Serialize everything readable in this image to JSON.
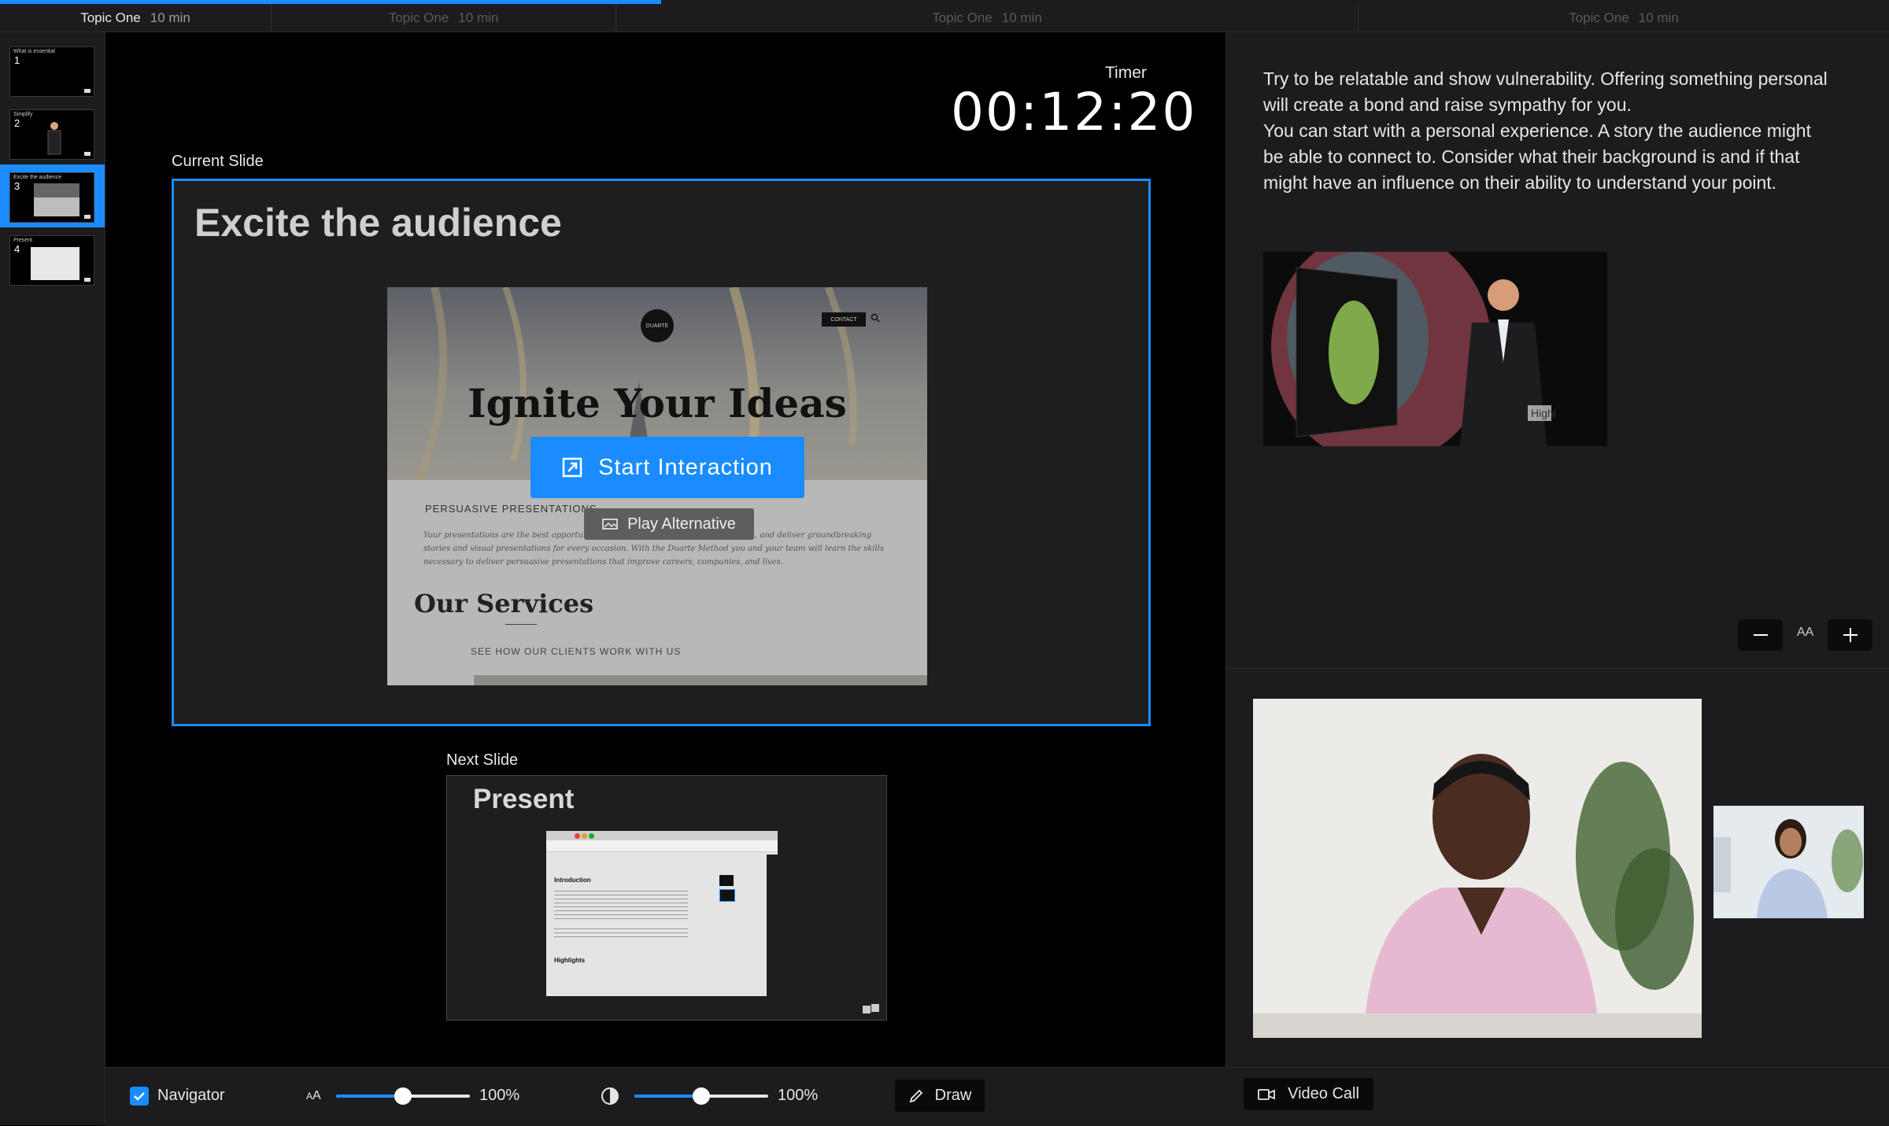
{
  "topic_bar": {
    "segments": [
      {
        "name": "Topic One",
        "duration": "10 min",
        "active": true
      },
      {
        "name": "Topic One",
        "duration": "10 min",
        "active": false
      },
      {
        "name": "Topic One",
        "duration": "10 min",
        "active": false
      },
      {
        "name": "Topic One",
        "duration": "10 min",
        "active": false
      }
    ],
    "progress": 0.35,
    "accent_color": "#1a8cff"
  },
  "sidebar": {
    "thumbnails": [
      {
        "number": "1",
        "title": "What is essential"
      },
      {
        "number": "2",
        "title": "Simplify"
      },
      {
        "number": "3",
        "title": "Excite the audience",
        "selected": true
      },
      {
        "number": "4",
        "title": "Present"
      }
    ]
  },
  "timer": {
    "label": "Timer",
    "value": "00:12:20"
  },
  "current_slide": {
    "label": "Current Slide",
    "title": "Excite the audience",
    "web_preview": {
      "logo": "DUARTE",
      "contact": "CONTACT",
      "headline": "Ignite Your Ideas",
      "section_label": "PERSUASIVE PRESENTATIONS",
      "body": "Your presentations are the best opportunity ... At Duarte we help you write, design, and deliver groundbreaking stories and visual presentations for every occasion. With the Duarte Method you and your team will learn the skills necessary to deliver persuasive presentations that improve careers, companies, and lives.",
      "services_heading": "Our Services",
      "see_clients": "SEE HOW OUR CLIENTS WORK WITH US"
    },
    "start_button": "Start Interaction",
    "play_alternative": "Play Alternative"
  },
  "next_slide": {
    "label": "Next Slide",
    "title": "Present",
    "preview": {
      "heading": "Introduction",
      "highlights": "Highlights"
    }
  },
  "notes": {
    "paragraphs": [
      "Try to be relatable and show vulnerability. Offering something personal will create a bond and raise sympathy for you.",
      "You can start with a personal experience. A story the audience might be able to connect to. Consider what their background is and if that might have an influence on their ability to understand your point."
    ],
    "image_caption": "Highl"
  },
  "font_controls": {
    "aa_label": "AA"
  },
  "bottom_bar": {
    "navigator": {
      "label": "Navigator",
      "checked": true
    },
    "font_scale": {
      "label_icon": "text-size-icon",
      "value": "100%",
      "fraction": 0.5
    },
    "contrast": {
      "label_icon": "contrast-icon",
      "value": "100%",
      "fraction": 0.5
    },
    "draw_button": "Draw",
    "video_call_button": "Video Call"
  }
}
